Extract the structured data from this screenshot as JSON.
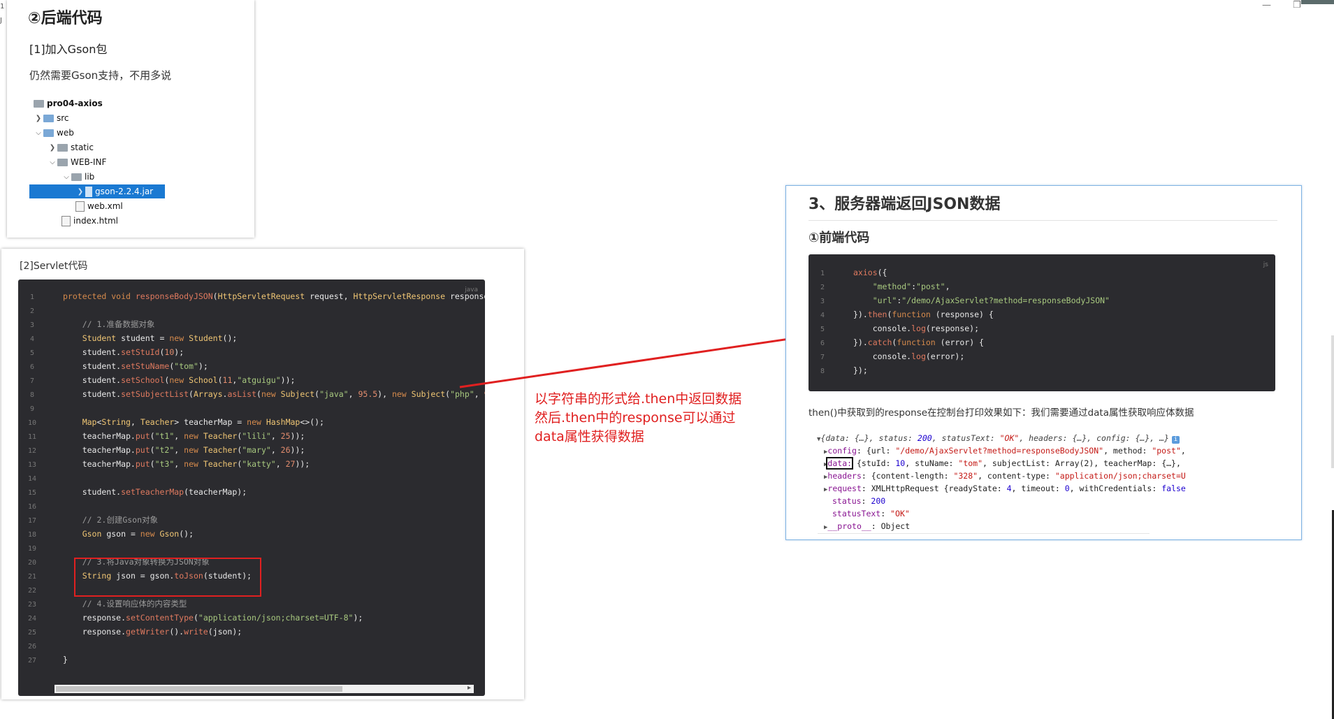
{
  "window": {
    "minimize_glyph": "—",
    "restore_glyph": "❐",
    "left_edge_chars": [
      "1",
      "J"
    ]
  },
  "left_panel": {
    "heading": "②后端代码",
    "subheading": "[1]加入Gson包",
    "paragraph": "仍然需要Gson支持，不用多说",
    "tree": [
      {
        "label": "pro04-axios",
        "icon": "project-folder-icon",
        "expanded": null
      },
      {
        "label": "src",
        "icon": "source-folder-icon",
        "expanded": false
      },
      {
        "label": "web",
        "icon": "web-folder-icon",
        "expanded": true
      },
      {
        "label": "static",
        "icon": "folder-icon",
        "expanded": false
      },
      {
        "label": "WEB-INF",
        "icon": "folder-icon",
        "expanded": true
      },
      {
        "label": "lib",
        "icon": "folder-icon",
        "expanded": true
      },
      {
        "label": "gson-2.2.4.jar",
        "icon": "jar-icon",
        "expanded": false,
        "selected": true
      },
      {
        "label": "web.xml",
        "icon": "xml-file-icon",
        "expanded": null
      },
      {
        "label": "index.html",
        "icon": "html-file-icon",
        "expanded": null
      }
    ]
  },
  "servlet_panel": {
    "title": "[2]Servlet代码",
    "lang": "java",
    "line_numbers": [
      "1",
      "2",
      "3",
      "4",
      "5",
      "6",
      "7",
      "8",
      "9",
      "10",
      "11",
      "12",
      "13",
      "14",
      "15",
      "16",
      "17",
      "18",
      "19",
      "20",
      "21",
      "22",
      "23",
      "24",
      "25",
      "26",
      "27"
    ]
  },
  "annotation": {
    "line1": "以字符串的形式给.then中返回数据",
    "line2": "然后.then中的response可以通过",
    "line3": "data属性获得数据",
    "arrow_color": "#e02020"
  },
  "right_panel": {
    "title": "3、服务器端返回JSON数据",
    "subtitle": "①前端代码",
    "lang": "js",
    "line_numbers": [
      "1",
      "2",
      "3",
      "4",
      "5",
      "6",
      "7",
      "8"
    ],
    "description": "then()中获取到的response在控制台打印效果如下：我们需要通过data属性获取响应体数据"
  },
  "colors": {
    "code_bg": "#2b2b2f",
    "selection": "#1a79d2",
    "highlight_red": "#e02020",
    "panel_border": "#7fb3e3"
  }
}
